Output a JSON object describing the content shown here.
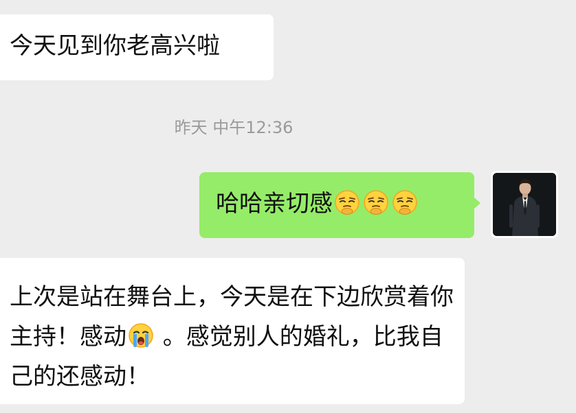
{
  "messages": [
    {
      "direction": "incoming",
      "text": "今天见到你老高兴啦"
    },
    {
      "direction": "outgoing",
      "text": "哈哈亲切感",
      "emoji": [
        "smirk-emoji",
        "smirk-emoji",
        "smirk-emoji"
      ]
    },
    {
      "direction": "incoming",
      "text_before_emoji": "上次是站在舞台上，今天是在下边欣赏着你主持！感动",
      "emoji": "crying-emoji",
      "text_after_emoji": " 。感觉别人的婚礼，比我自己的还感动！"
    }
  ],
  "timestamp": "昨天 中午12:36",
  "avatar": {
    "icon": "user-avatar-photo"
  },
  "colors": {
    "background": "#ededed",
    "incoming_bubble": "#ffffff",
    "outgoing_bubble": "#95ec69",
    "timestamp_text": "#9a9a9a"
  }
}
